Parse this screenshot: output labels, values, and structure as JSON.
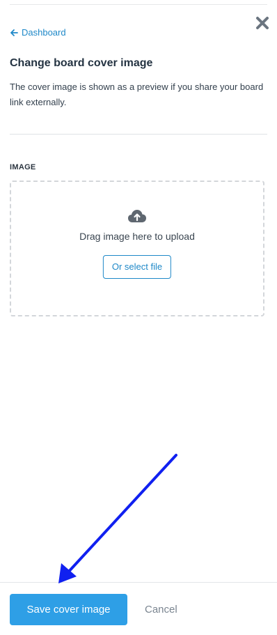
{
  "panel": {
    "back_link_label": "Dashboard",
    "title": "Change board cover image",
    "description": "The cover image is shown as a preview if you share your board link externally."
  },
  "image_section": {
    "label": "IMAGE",
    "drag_text": "Drag image here to upload",
    "select_file_label": "Or select file"
  },
  "footer": {
    "save_label": "Save cover image",
    "cancel_label": "Cancel"
  },
  "icons": {
    "close": "close-icon",
    "back": "arrow-left-icon",
    "upload": "cloud-upload-icon"
  },
  "colors": {
    "accent": "#1e88c8",
    "primary_button": "#2e9fe6",
    "annotation_arrow": "#1020f0"
  }
}
